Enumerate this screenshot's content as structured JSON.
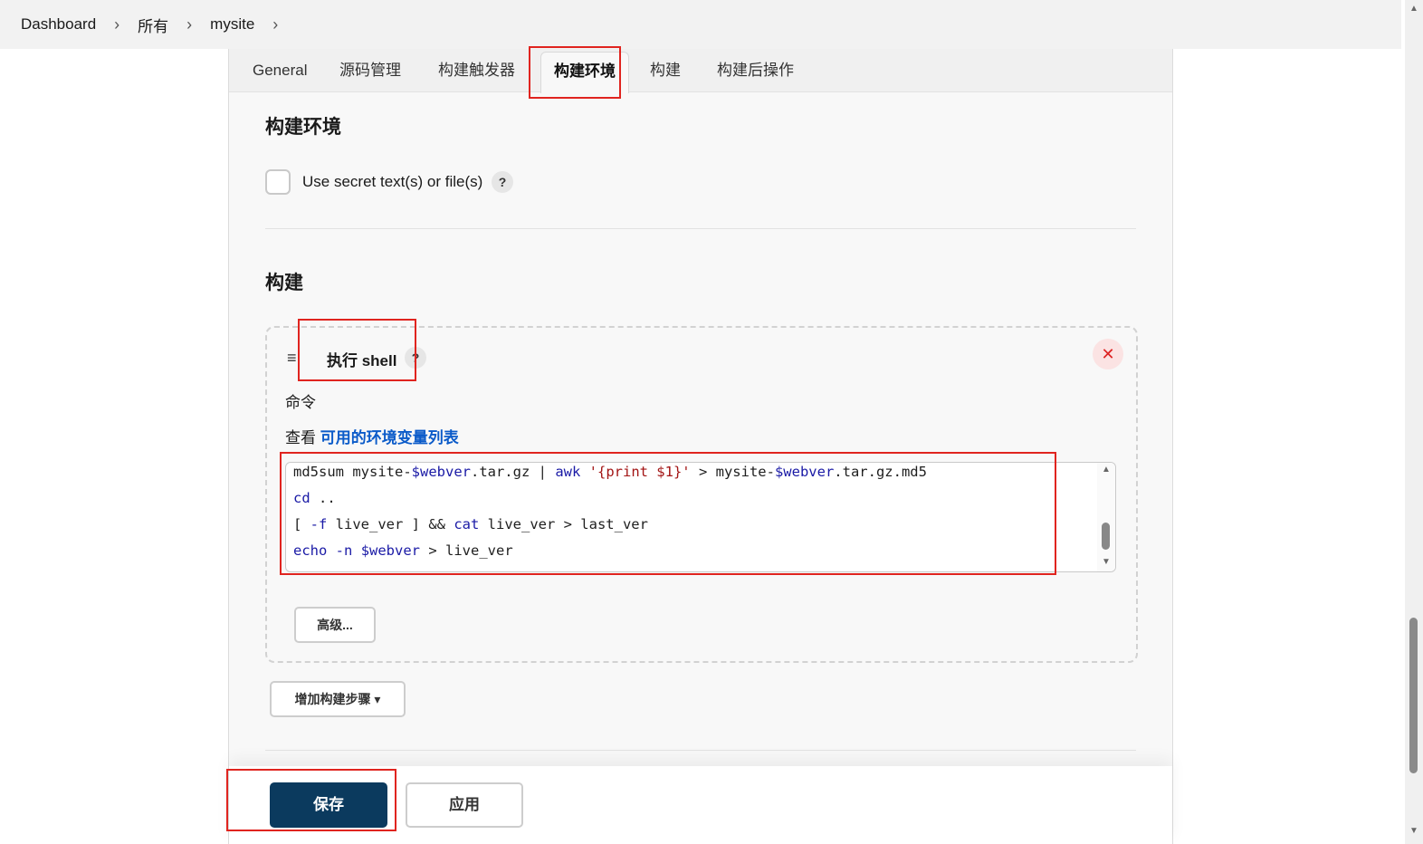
{
  "breadcrumb": {
    "items": [
      "Dashboard",
      "所有",
      "mysite"
    ],
    "separator": ">"
  },
  "tabs": [
    {
      "label": "General"
    },
    {
      "label": "源码管理"
    },
    {
      "label": "构建触发器"
    },
    {
      "label": "构建环境",
      "active": true
    },
    {
      "label": "构建"
    },
    {
      "label": "构建后操作"
    }
  ],
  "build_env": {
    "title": "构建环境",
    "secret_checkbox_label": "Use secret text(s) or file(s)",
    "secret_checked": false,
    "help": "?"
  },
  "build": {
    "title": "构建",
    "step": {
      "title": "执行 shell",
      "help": "?",
      "close": "✕",
      "command_label": "命令",
      "env_prefix": "查看",
      "env_link": "可用的环境变量列表",
      "code_lines": [
        "md5sum mysite-$webver.tar.gz | awk '{print $1}' > mysite-$webver.tar.gz.md5",
        "cd ..",
        "[ -f live_ver ] && cat live_ver > last_ver",
        "echo -n $webver > live_ver"
      ],
      "advanced_label": "高级..."
    },
    "add_step_label": "增加构建步骤"
  },
  "footer": {
    "save_label": "保存",
    "apply_label": "应用"
  },
  "colors": {
    "primary_button": "#0b3a5e",
    "link": "#0b5bc9",
    "annotation": "#e0241f"
  }
}
